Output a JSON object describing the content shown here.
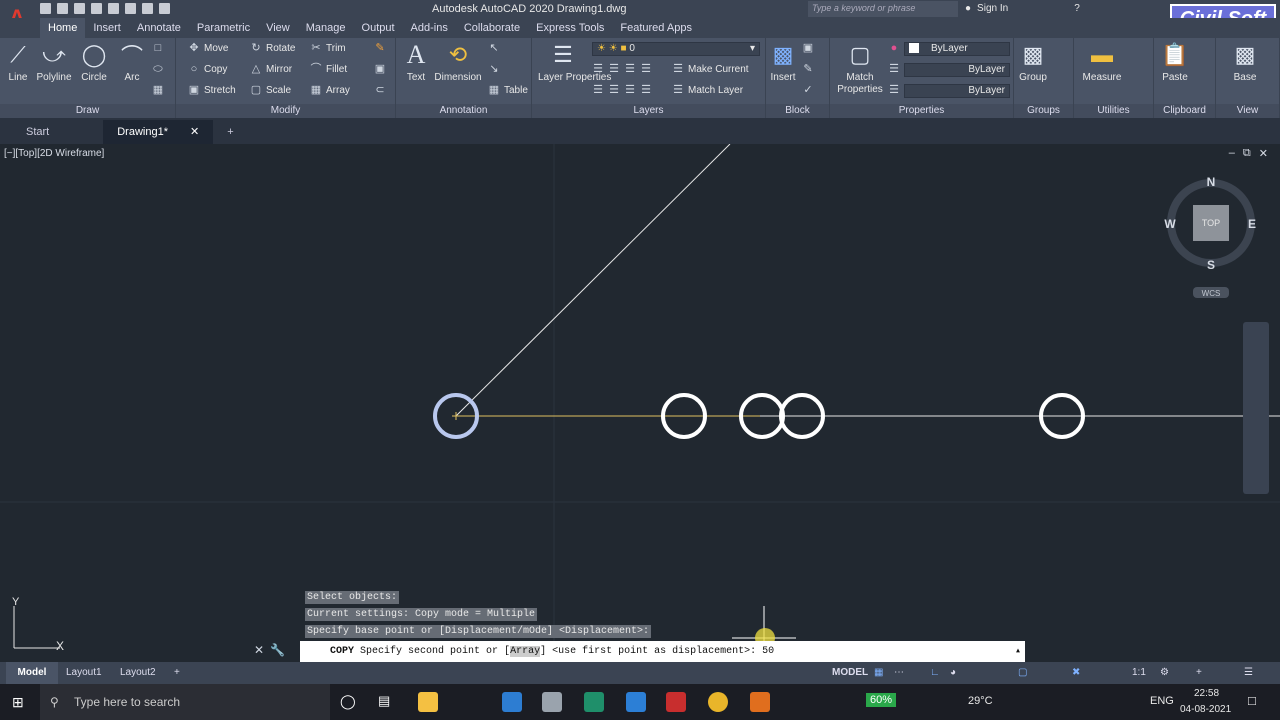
{
  "app": {
    "logo_letter": "A",
    "title": "Autodesk AutoCAD 2020    Drawing1.dwg",
    "search_placeholder": "Type a keyword or phrase",
    "sign_in": "Sign In",
    "brand_logo": "Civil Soft"
  },
  "tabs": [
    "Home",
    "Insert",
    "Annotate",
    "Parametric",
    "View",
    "Manage",
    "Output",
    "Add-ins",
    "Collaborate",
    "Express Tools",
    "Featured Apps"
  ],
  "ribbon": {
    "draw": {
      "title": "Draw",
      "line": "Line",
      "polyline": "Polyline",
      "circle": "Circle",
      "arc": "Arc"
    },
    "modify": {
      "title": "Modify",
      "move": "Move",
      "rotate": "Rotate",
      "trim": "Trim",
      "copy": "Copy",
      "mirror": "Mirror",
      "fillet": "Fillet",
      "stretch": "Stretch",
      "scale": "Scale",
      "array": "Array"
    },
    "annotation": {
      "title": "Annotation",
      "text": "Text",
      "dimension": "Dimension",
      "table": "Table"
    },
    "layers": {
      "title": "Layers",
      "layer_properties": "Layer Properties",
      "current_layer": "0",
      "make_current": "Make Current",
      "match_layer": "Match Layer"
    },
    "block": {
      "title": "Block",
      "insert": "Insert"
    },
    "properties": {
      "title": "Properties",
      "match_properties": "Match Properties",
      "color": "ByLayer",
      "linetype": "ByLayer",
      "lineweight": "ByLayer"
    },
    "groups": {
      "title": "Groups",
      "group": "Group"
    },
    "utilities": {
      "title": "Utilities",
      "measure": "Measure"
    },
    "clipboard": {
      "title": "Clipboard",
      "paste": "Paste"
    },
    "view": {
      "title": "View",
      "base": "Base"
    }
  },
  "file_tabs": {
    "start": "Start",
    "drawing": "Drawing1*"
  },
  "viewport": {
    "label": "[−][Top][2D Wireframe]",
    "compass": {
      "n": "N",
      "s": "S",
      "e": "E",
      "w": "W",
      "top": "TOP",
      "wcs": "WCS"
    }
  },
  "command": {
    "history": [
      "Select objects:",
      "Current settings:  Copy mode = Multiple",
      "Specify base point or [Displacement/mOde] <Displacement>:"
    ],
    "prompt_cmd": "COPY",
    "prompt_pre": "Specify second point or [",
    "prompt_opt": "Array",
    "prompt_post": "] <use first point as displacement>:",
    "input_value": "50"
  },
  "layouts": [
    "Model",
    "Layout1",
    "Layout2"
  ],
  "status": {
    "model": "MODEL",
    "scale": "1:1"
  },
  "taskbar": {
    "search": "Type here to search",
    "battery": "60%",
    "temp": "29°C",
    "lang": "ENG",
    "time": "22:58",
    "date": "04-08-2021"
  }
}
